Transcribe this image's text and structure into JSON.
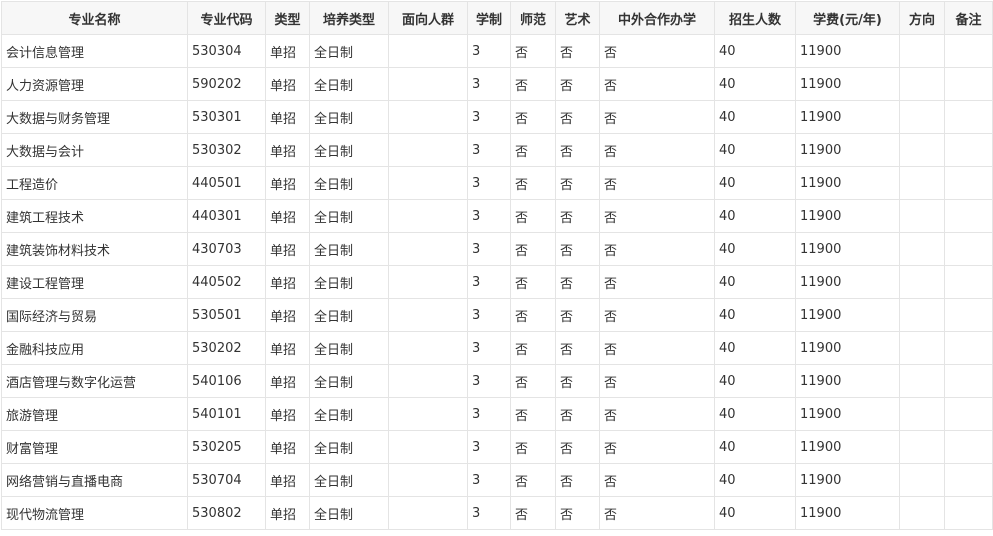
{
  "table": {
    "headers": [
      "专业名称",
      "专业代码",
      "类型",
      "培养类型",
      "面向人群",
      "学制",
      "师范",
      "艺术",
      "中外合作办学",
      "招生人数",
      "学费(元/年)",
      "方向",
      "备注"
    ],
    "rows": [
      [
        "会计信息管理",
        "530304",
        "单招",
        "全日制",
        "",
        "3",
        "否",
        "否",
        "否",
        "40",
        "11900",
        "",
        ""
      ],
      [
        "人力资源管理",
        "590202",
        "单招",
        "全日制",
        "",
        "3",
        "否",
        "否",
        "否",
        "40",
        "11900",
        "",
        ""
      ],
      [
        "大数据与财务管理",
        "530301",
        "单招",
        "全日制",
        "",
        "3",
        "否",
        "否",
        "否",
        "40",
        "11900",
        "",
        ""
      ],
      [
        "大数据与会计",
        "530302",
        "单招",
        "全日制",
        "",
        "3",
        "否",
        "否",
        "否",
        "40",
        "11900",
        "",
        ""
      ],
      [
        "工程造价",
        "440501",
        "单招",
        "全日制",
        "",
        "3",
        "否",
        "否",
        "否",
        "40",
        "11900",
        "",
        ""
      ],
      [
        "建筑工程技术",
        "440301",
        "单招",
        "全日制",
        "",
        "3",
        "否",
        "否",
        "否",
        "40",
        "11900",
        "",
        ""
      ],
      [
        "建筑装饰材料技术",
        "430703",
        "单招",
        "全日制",
        "",
        "3",
        "否",
        "否",
        "否",
        "40",
        "11900",
        "",
        ""
      ],
      [
        "建设工程管理",
        "440502",
        "单招",
        "全日制",
        "",
        "3",
        "否",
        "否",
        "否",
        "40",
        "11900",
        "",
        ""
      ],
      [
        "国际经济与贸易",
        "530501",
        "单招",
        "全日制",
        "",
        "3",
        "否",
        "否",
        "否",
        "40",
        "11900",
        "",
        ""
      ],
      [
        "金融科技应用",
        "530202",
        "单招",
        "全日制",
        "",
        "3",
        "否",
        "否",
        "否",
        "40",
        "11900",
        "",
        ""
      ],
      [
        "酒店管理与数字化运营",
        "540106",
        "单招",
        "全日制",
        "",
        "3",
        "否",
        "否",
        "否",
        "40",
        "11900",
        "",
        ""
      ],
      [
        "旅游管理",
        "540101",
        "单招",
        "全日制",
        "",
        "3",
        "否",
        "否",
        "否",
        "40",
        "11900",
        "",
        ""
      ],
      [
        "财富管理",
        "530205",
        "单招",
        "全日制",
        "",
        "3",
        "否",
        "否",
        "否",
        "40",
        "11900",
        "",
        ""
      ],
      [
        "网络营销与直播电商",
        "530704",
        "单招",
        "全日制",
        "",
        "3",
        "否",
        "否",
        "否",
        "40",
        "11900",
        "",
        ""
      ],
      [
        "现代物流管理",
        "530802",
        "单招",
        "全日制",
        "",
        "3",
        "否",
        "否",
        "否",
        "40",
        "11900",
        "",
        ""
      ]
    ]
  }
}
